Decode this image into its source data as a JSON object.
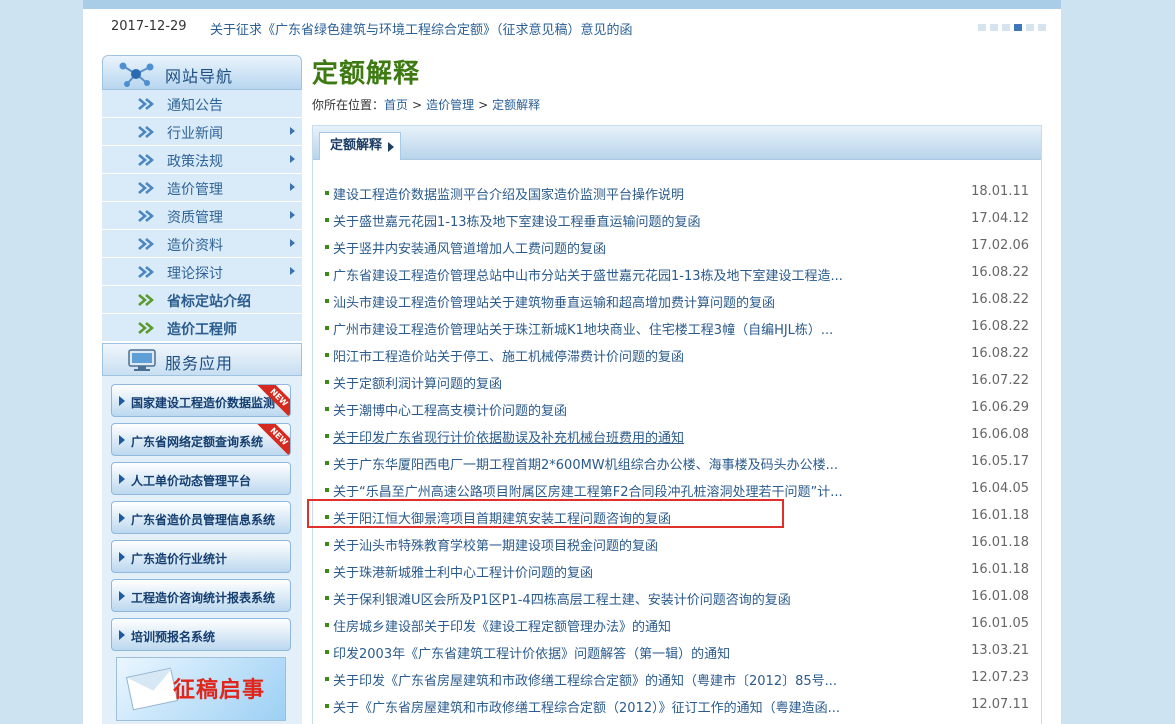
{
  "notice": {
    "date": "2017-12-29",
    "text": "关于征求《广东省绿色建筑与环境工程综合定额》（征求意见稿）意见的函"
  },
  "sidebar": {
    "nav_title": "网站导航",
    "nav_items": [
      {
        "label": "通知公告",
        "has_arrow": false,
        "bold": false
      },
      {
        "label": "行业新闻",
        "has_arrow": true,
        "bold": false
      },
      {
        "label": "政策法规",
        "has_arrow": true,
        "bold": false
      },
      {
        "label": "造价管理",
        "has_arrow": true,
        "bold": false
      },
      {
        "label": "资质管理",
        "has_arrow": true,
        "bold": false
      },
      {
        "label": "造价资料",
        "has_arrow": true,
        "bold": false
      },
      {
        "label": "理论探讨",
        "has_arrow": true,
        "bold": false
      },
      {
        "label": "省标定站介绍",
        "has_arrow": false,
        "bold": true
      },
      {
        "label": "造价工程师",
        "has_arrow": false,
        "bold": true
      }
    ],
    "services_title": "服务应用",
    "services": [
      {
        "label": "国家建设工程造价数据监测",
        "new": true
      },
      {
        "label": "广东省网络定额查询系统",
        "new": true
      },
      {
        "label": "人工单价动态管理平台",
        "new": false
      },
      {
        "label": "广东省造价员管理信息系统",
        "new": false
      },
      {
        "label": "广东造价行业统计",
        "new": false
      },
      {
        "label": "工程造价咨询统计报表系统",
        "new": false
      },
      {
        "label": "培训预报名系统",
        "new": false
      }
    ],
    "new_badge": "NEW",
    "banner_text": "征稿启事"
  },
  "main": {
    "title": "定额解释",
    "breadcrumb": {
      "prefix": "你所在位置：",
      "items": [
        "首页",
        "造价管理",
        "定额解释"
      ],
      "separator": ">"
    },
    "tab_label": "定额解释",
    "articles": [
      {
        "title": "建设工程造价数据监测平台介绍及国家造价监测平台操作说明",
        "date": "18.01.11"
      },
      {
        "title": "关于盛世嘉元花园1-13栋及地下室建设工程垂直运输问题的复函",
        "date": "17.04.12"
      },
      {
        "title": "关于竖井内安装通风管道增加人工费问题的复函",
        "date": "17.02.06"
      },
      {
        "title": "广东省建设工程造价管理总站中山市分站关于盛世嘉元花园1-13栋及地下室建设工程造...",
        "date": "16.08.22"
      },
      {
        "title": "汕头市建设工程造价管理站关于建筑物垂直运输和超高增加费计算问题的复函",
        "date": "16.08.22"
      },
      {
        "title": "广州市建设工程造价管理站关于珠江新城K1地块商业、住宅楼工程3幢（自编HJL栋）...",
        "date": "16.08.22"
      },
      {
        "title": "阳江市工程造价站关于停工、施工机械停滞费计价问题的复函",
        "date": "16.08.22"
      },
      {
        "title": "关于定额利润计算问题的复函",
        "date": "16.07.22"
      },
      {
        "title": "关于潮博中心工程高支模计价问题的复函",
        "date": "16.06.29"
      },
      {
        "title": "关于印发广东省现行计价依据勘误及补充机械台班费用的通知",
        "date": "16.06.08"
      },
      {
        "title": "关于广东华厦阳西电厂一期工程首期2*600MW机组综合办公楼、海事楼及码头办公楼...",
        "date": "16.05.17"
      },
      {
        "title": "关于“乐昌至广州高速公路项目附属区房建工程第F2合同段冲孔桩溶洞处理若干问题”计...",
        "date": "16.04.05"
      },
      {
        "title": "关于阳江恒大御景湾项目首期建筑安装工程问题咨询的复函",
        "date": "16.01.18"
      },
      {
        "title": "关于汕头市特殊教育学校第一期建设项目税金问题的复函",
        "date": "16.01.18"
      },
      {
        "title": "关于珠港新城雅士利中心工程计价问题的复函",
        "date": "16.01.18"
      },
      {
        "title": "关于保利银滩U区会所及P1区P1-4四栋高层工程土建、安装计价问题咨询的复函",
        "date": "16.01.08"
      },
      {
        "title": "住房城乡建设部关于印发《建设工程定额管理办法》的通知",
        "date": "16.01.05"
      },
      {
        "title": "印发2003年《广东省建筑工程计价依据》问题解答（第一辑）的通知",
        "date": "13.03.21"
      },
      {
        "title": "关于印发《广东省房屋建筑和市政修缮工程综合定额》的通知（粤建市〔2012〕85号...",
        "date": "12.07.23"
      },
      {
        "title": "关于《广东省房屋建筑和市政修缮工程综合定额（2012）》征订工作的通知（粤建造函...",
        "date": "12.07.11"
      }
    ]
  },
  "colors": {
    "title_green": "#3d7a12",
    "link_blue": "#2b5b8c",
    "highlight_red": "#e0302b"
  }
}
